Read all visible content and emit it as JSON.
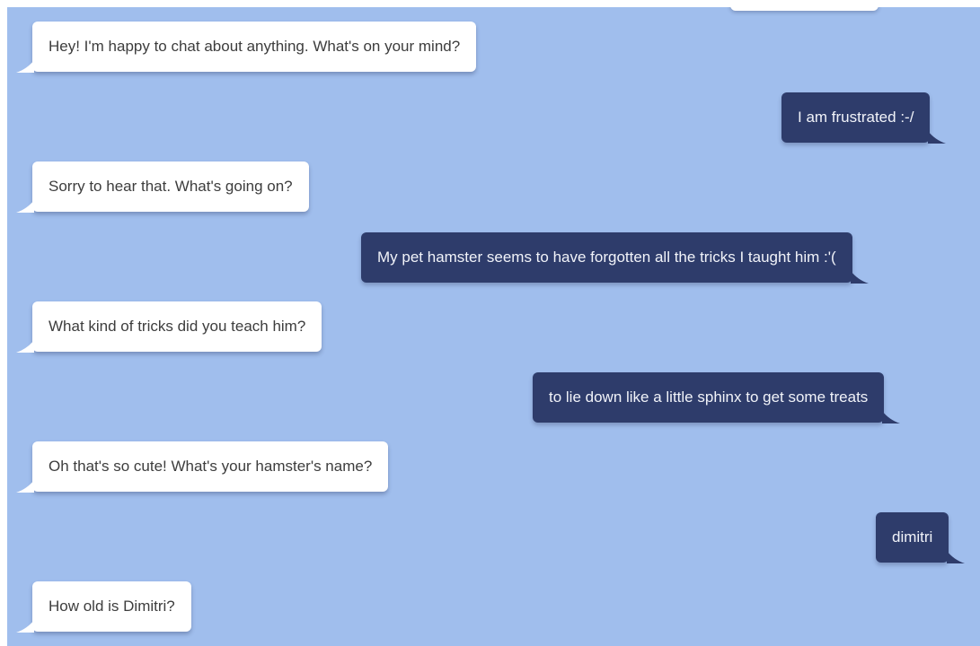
{
  "messages": [
    {
      "sender": "bot",
      "text": "Hey! I'm happy to chat about anything. What's on your mind?"
    },
    {
      "sender": "user",
      "text": "I am frustrated :-/"
    },
    {
      "sender": "bot",
      "text": "Sorry to hear that. What's going on?"
    },
    {
      "sender": "user",
      "text": "My pet hamster seems to have forgotten all the tricks I taught him :'("
    },
    {
      "sender": "bot",
      "text": "What kind of tricks did you teach him?"
    },
    {
      "sender": "user",
      "text": "to lie down like a little sphinx to get some treats"
    },
    {
      "sender": "bot",
      "text": "Oh that's so cute! What's your hamster's name?"
    },
    {
      "sender": "user",
      "text": "dimitri"
    },
    {
      "sender": "bot",
      "text": "How old is Dimitri?"
    }
  ],
  "colors": {
    "chat_background": "#a0beed",
    "bot_bubble": "#ffffff",
    "bot_text": "#3d3d3d",
    "user_bubble": "#2e3c6b",
    "user_text": "#f1f3f9"
  }
}
